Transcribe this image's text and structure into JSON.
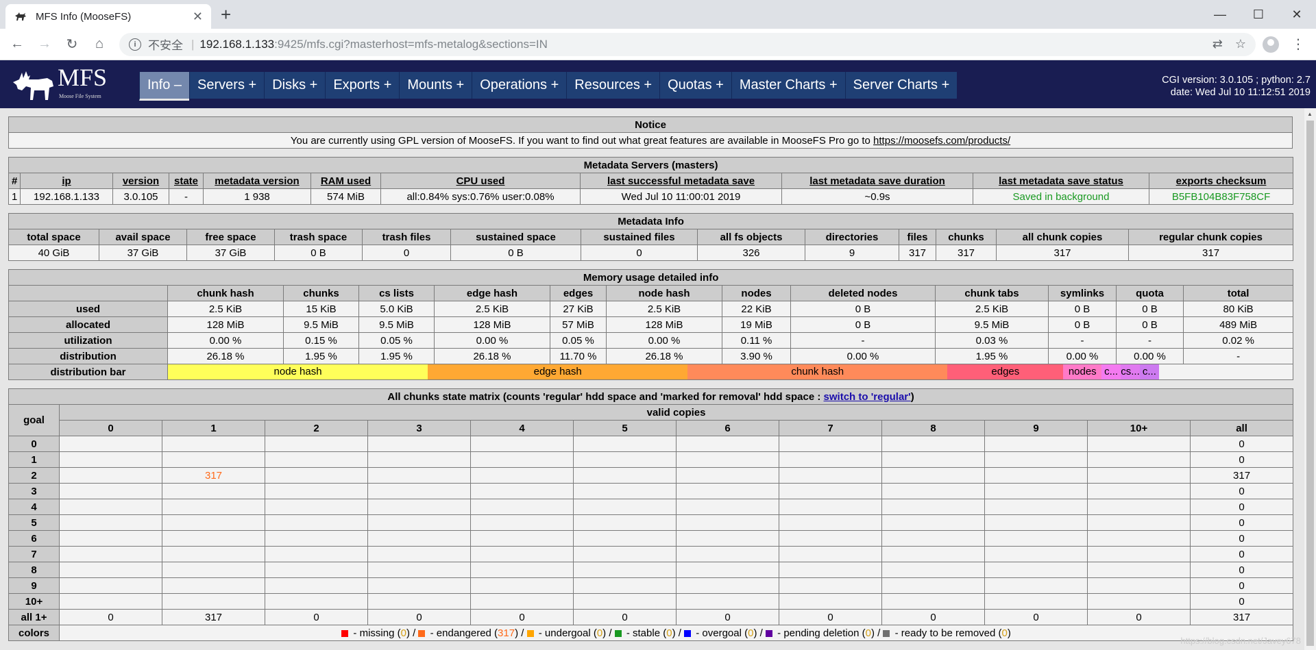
{
  "browser": {
    "tab_title": "MFS Info (MooseFS)",
    "tab_close": "✕",
    "new_tab": "+",
    "window_controls": [
      "—",
      "☐",
      "✕"
    ],
    "not_secure": "不安全",
    "url_host": "192.168.1.133",
    "url_rest": ":9425/mfs.cgi?masterhost=mfs-metalog&sections=IN"
  },
  "header": {
    "logo_text": "MFS",
    "logo_sub": "Moose File System",
    "menu": [
      "Info –",
      "Servers +",
      "Disks +",
      "Exports +",
      "Mounts +",
      "Operations +",
      "Resources +",
      "Quotas +",
      "Master Charts +",
      "Server Charts +"
    ],
    "cgi_version": "CGI version: 3.0.105 ; python: 2.7",
    "date": "date: Wed Jul 10 11:12:51 2019"
  },
  "notice": {
    "title": "Notice",
    "text": "You are currently using GPL version of MooseFS. If you want to find out what great features are available in MooseFS Pro go to ",
    "link": "https://moosefs.com/products/"
  },
  "masters": {
    "title": "Metadata Servers (masters)",
    "headers": [
      "#",
      "ip",
      "version",
      "state",
      "metadata version",
      "RAM used",
      "CPU used",
      "last successful metadata save",
      "last metadata save duration",
      "last metadata save status",
      "exports checksum"
    ],
    "row": [
      "1",
      "192.168.1.133",
      "3.0.105",
      "-",
      "1 938",
      "574 MiB",
      "all:0.84% sys:0.76% user:0.08%",
      "Wed Jul 10 11:00:01 2019",
      "~0.9s",
      "Saved in background",
      "B5FB104B83F758CF"
    ]
  },
  "metainfo": {
    "title": "Metadata Info",
    "headers": [
      "total space",
      "avail space",
      "free space",
      "trash space",
      "trash files",
      "sustained space",
      "sustained files",
      "all fs objects",
      "directories",
      "files",
      "chunks",
      "all chunk copies",
      "regular chunk copies"
    ],
    "row": [
      "40 GiB",
      "37 GiB",
      "37 GiB",
      "0 B",
      "0",
      "0 B",
      "0",
      "326",
      "9",
      "317",
      "317",
      "317",
      "317"
    ]
  },
  "memory": {
    "title": "Memory usage detailed info",
    "headers": [
      "chunk hash",
      "chunks",
      "cs lists",
      "edge hash",
      "edges",
      "node hash",
      "nodes",
      "deleted nodes",
      "chunk tabs",
      "symlinks",
      "quota",
      "total"
    ],
    "rows": [
      {
        "label": "used",
        "cells": [
          "2.5 KiB",
          "15 KiB",
          "5.0 KiB",
          "2.5 KiB",
          "27 KiB",
          "2.5 KiB",
          "22 KiB",
          "0 B",
          "2.5 KiB",
          "0 B",
          "0 B",
          "80 KiB"
        ]
      },
      {
        "label": "allocated",
        "cells": [
          "128 MiB",
          "9.5 MiB",
          "9.5 MiB",
          "128 MiB",
          "57 MiB",
          "128 MiB",
          "19 MiB",
          "0 B",
          "9.5 MiB",
          "0 B",
          "0 B",
          "489 MiB"
        ]
      },
      {
        "label": "utilization",
        "cells": [
          "0.00 %",
          "0.15 %",
          "0.05 %",
          "0.00 %",
          "0.05 %",
          "0.00 %",
          "0.11 %",
          "-",
          "0.03 %",
          "-",
          "-",
          "0.02 %"
        ]
      },
      {
        "label": "distribution",
        "cells": [
          "26.18 %",
          "1.95 %",
          "1.95 %",
          "26.18 %",
          "11.70 %",
          "26.18 %",
          "3.90 %",
          "0.00 %",
          "1.95 %",
          "0.00 %",
          "0.00 %",
          "-"
        ]
      }
    ],
    "bar_label": "distribution bar",
    "bar": [
      {
        "label": "node hash",
        "pct": 23.1,
        "color": "#ffff5a"
      },
      {
        "label": "edge hash",
        "pct": 23.1,
        "color": "#ffa833"
      },
      {
        "label": "chunk hash",
        "pct": 23.1,
        "color": "#ff8a5a"
      },
      {
        "label": "edges",
        "pct": 10.3,
        "color": "#ff5f78"
      },
      {
        "label": "nodes",
        "pct": 3.4,
        "color": "#ff7ac8"
      },
      {
        "label": "c...",
        "pct": 1.7,
        "color": "#f47af0"
      },
      {
        "label": "cs...",
        "pct": 1.7,
        "color": "#e07af0"
      },
      {
        "label": "c...",
        "pct": 1.7,
        "color": "#cc7af0"
      }
    ]
  },
  "matrix": {
    "title_pre": "All chunks state matrix (counts 'regular' hdd space and 'marked for removal' hdd space : ",
    "title_link": "switch to 'regular'",
    "title_post": ")",
    "goal_label": "goal",
    "valid_copies_label": "valid copies",
    "cols": [
      "0",
      "1",
      "2",
      "3",
      "4",
      "5",
      "6",
      "7",
      "8",
      "9",
      "10+",
      "all"
    ],
    "rows": [
      {
        "goal": "0",
        "cells": [
          "",
          "",
          "",
          "",
          "",
          "",
          "",
          "",
          "",
          "",
          "",
          "0"
        ]
      },
      {
        "goal": "1",
        "cells": [
          "",
          "",
          "",
          "",
          "",
          "",
          "",
          "",
          "",
          "",
          "",
          "0"
        ]
      },
      {
        "goal": "2",
        "cells": [
          "",
          "317",
          "",
          "",
          "",
          "",
          "",
          "",
          "",
          "",
          "",
          "317"
        ]
      },
      {
        "goal": "3",
        "cells": [
          "",
          "",
          "",
          "",
          "",
          "",
          "",
          "",
          "",
          "",
          "",
          "0"
        ]
      },
      {
        "goal": "4",
        "cells": [
          "",
          "",
          "",
          "",
          "",
          "",
          "",
          "",
          "",
          "",
          "",
          "0"
        ]
      },
      {
        "goal": "5",
        "cells": [
          "",
          "",
          "",
          "",
          "",
          "",
          "",
          "",
          "",
          "",
          "",
          "0"
        ]
      },
      {
        "goal": "6",
        "cells": [
          "",
          "",
          "",
          "",
          "",
          "",
          "",
          "",
          "",
          "",
          "",
          "0"
        ]
      },
      {
        "goal": "7",
        "cells": [
          "",
          "",
          "",
          "",
          "",
          "",
          "",
          "",
          "",
          "",
          "",
          "0"
        ]
      },
      {
        "goal": "8",
        "cells": [
          "",
          "",
          "",
          "",
          "",
          "",
          "",
          "",
          "",
          "",
          "",
          "0"
        ]
      },
      {
        "goal": "9",
        "cells": [
          "",
          "",
          "",
          "",
          "",
          "",
          "",
          "",
          "",
          "",
          "",
          "0"
        ]
      },
      {
        "goal": "10+",
        "cells": [
          "",
          "",
          "",
          "",
          "",
          "",
          "",
          "",
          "",
          "",
          "",
          "0"
        ]
      },
      {
        "goal": "all 1+",
        "cells": [
          "0",
          "317",
          "0",
          "0",
          "0",
          "0",
          "0",
          "0",
          "0",
          "0",
          "0",
          "317"
        ]
      }
    ],
    "colors_label": "colors",
    "legend": [
      {
        "color": "#ff0000",
        "name": "missing",
        "count": "0"
      },
      {
        "color": "#ff6a1a",
        "name": "endangered",
        "count": "317"
      },
      {
        "color": "#ffa500",
        "name": "undergoal",
        "count": "0"
      },
      {
        "color": "#199921",
        "name": "stable",
        "count": "0"
      },
      {
        "color": "#0000ff",
        "name": "overgoal",
        "count": "0"
      },
      {
        "color": "#6000a0",
        "name": "pending deletion",
        "count": "0"
      },
      {
        "color": "#707070",
        "name": "ready to be removed",
        "count": "0"
      }
    ]
  },
  "watermark": "https://blog.csdn.net/Javey678"
}
